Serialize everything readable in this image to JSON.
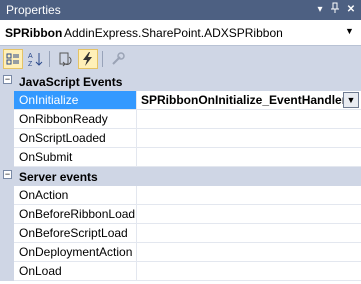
{
  "window": {
    "title": "Properties",
    "title_buttons": [
      "dropdown-arrow",
      "pin",
      "close"
    ]
  },
  "object_selector": {
    "name": "SPRibbon",
    "type": "AddinExpress.SharePoint.ADXSPRibbon"
  },
  "toolbar": {
    "buttons": [
      {
        "name": "categorized",
        "icon": "categorized-icon",
        "active": true
      },
      {
        "name": "alphabetical",
        "icon": "alphabetical-icon",
        "active": false
      },
      {
        "name": "properties",
        "icon": "properties-icon",
        "active": false
      },
      {
        "name": "events",
        "icon": "lightning-icon",
        "active": true
      },
      {
        "name": "property-pages",
        "icon": "wrench-icon",
        "active": false
      }
    ]
  },
  "grid": {
    "categories": [
      {
        "label": "JavaScript Events",
        "expanded": true,
        "items": [
          {
            "name": "OnInitialize",
            "value": "SPRibbonOnInitialize_EventHandler",
            "selected": true
          },
          {
            "name": "OnRibbonReady",
            "value": ""
          },
          {
            "name": "OnScriptLoaded",
            "value": ""
          },
          {
            "name": "OnSubmit",
            "value": ""
          }
        ]
      },
      {
        "label": "Server events",
        "expanded": true,
        "items": [
          {
            "name": "OnAction",
            "value": ""
          },
          {
            "name": "OnBeforeRibbonLoad",
            "value": ""
          },
          {
            "name": "OnBeforeScriptLoad",
            "value": ""
          },
          {
            "name": "OnDeploymentAction",
            "value": ""
          },
          {
            "name": "OnLoad",
            "value": ""
          }
        ]
      }
    ]
  },
  "colors": {
    "titlebar": "#4d6082",
    "panel": "#cfd6e5",
    "selection": "#3399ff"
  }
}
